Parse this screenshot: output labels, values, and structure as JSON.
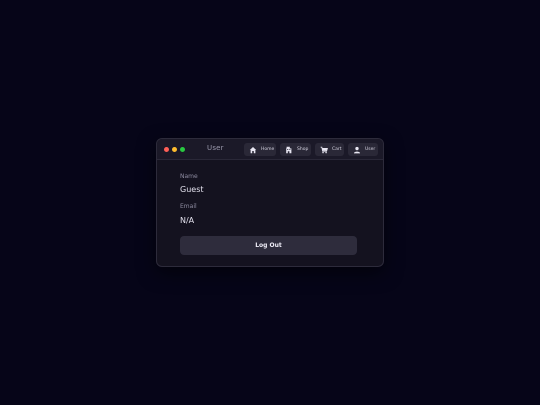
{
  "window": {
    "title": "User",
    "traffic_lights": {
      "close": "#ff5f57",
      "minimize": "#febc2e",
      "maximize": "#28c840"
    }
  },
  "nav": [
    {
      "label": "Home",
      "icon": "home-icon"
    },
    {
      "label": "Shop",
      "icon": "shop-icon"
    },
    {
      "label": "Cart",
      "icon": "cart-icon"
    },
    {
      "label": "User",
      "icon": "user-icon"
    }
  ],
  "profile": {
    "name_label": "Name",
    "name_value": "Guest",
    "email_label": "Email",
    "email_value": "N/A"
  },
  "actions": {
    "logout_label": "Log Out"
  }
}
